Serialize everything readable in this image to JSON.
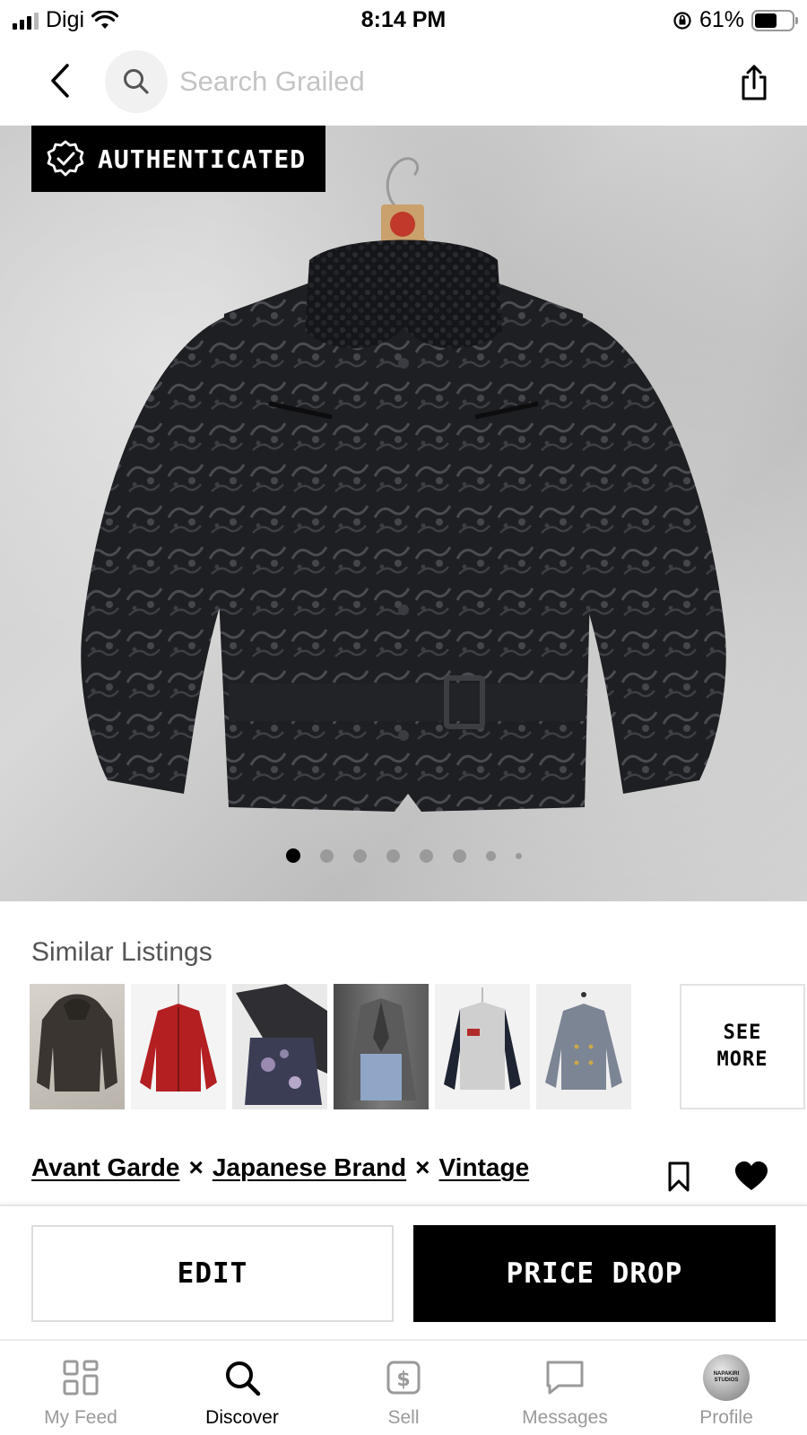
{
  "status_bar": {
    "carrier": "Digi",
    "time": "8:14 PM",
    "battery": "61%",
    "battery_fraction": 0.61,
    "signal_bars": 4,
    "signal_filled": 3
  },
  "header": {
    "back_icon": "chevron-left-icon",
    "search_icon": "search-icon",
    "search_placeholder": "Search Grailed",
    "share_icon": "share-icon"
  },
  "hero": {
    "authenticated_label": "AUTHENTICATED",
    "authenticated_icon": "verified-badge-icon",
    "image_count": 8,
    "active_index": 0
  },
  "similar": {
    "title": "Similar Listings",
    "see_more_line1": "SEE",
    "see_more_line2": "MORE",
    "items": [
      {
        "name": "dark-hooded-jacket",
        "color": "#3a3530"
      },
      {
        "name": "red-zip-jacket",
        "color": "#b41f22"
      },
      {
        "name": "dark-floral-jacket",
        "color": "#2f2f33"
      },
      {
        "name": "grey-denim-blazer",
        "color": "#6b6b6b"
      },
      {
        "name": "varsity-jacket",
        "color": "#cfcfcf"
      },
      {
        "name": "tweed-peacoat",
        "color": "#7c8594"
      }
    ]
  },
  "designers": {
    "items": [
      "Avant Garde",
      "Japanese Brand",
      "Vintage"
    ],
    "separator": "×"
  },
  "actions": {
    "edit_label": "EDIT",
    "price_drop_label": "PRICE DROP"
  },
  "nav": {
    "items": [
      {
        "label": "My Feed",
        "icon": "grid-icon"
      },
      {
        "label": "Discover",
        "icon": "search-icon"
      },
      {
        "label": "Sell",
        "icon": "dollar-tag-icon"
      },
      {
        "label": "Messages",
        "icon": "chat-bubble-icon"
      },
      {
        "label": "Profile",
        "icon": "avatar"
      }
    ],
    "active": "Discover",
    "avatar_text_1": "NAPAKIRI",
    "avatar_text_2": "STUDIOS"
  },
  "colors": {
    "accent": "#000000",
    "muted_text": "#9a9a9a",
    "placeholder": "#c4c4c4"
  }
}
